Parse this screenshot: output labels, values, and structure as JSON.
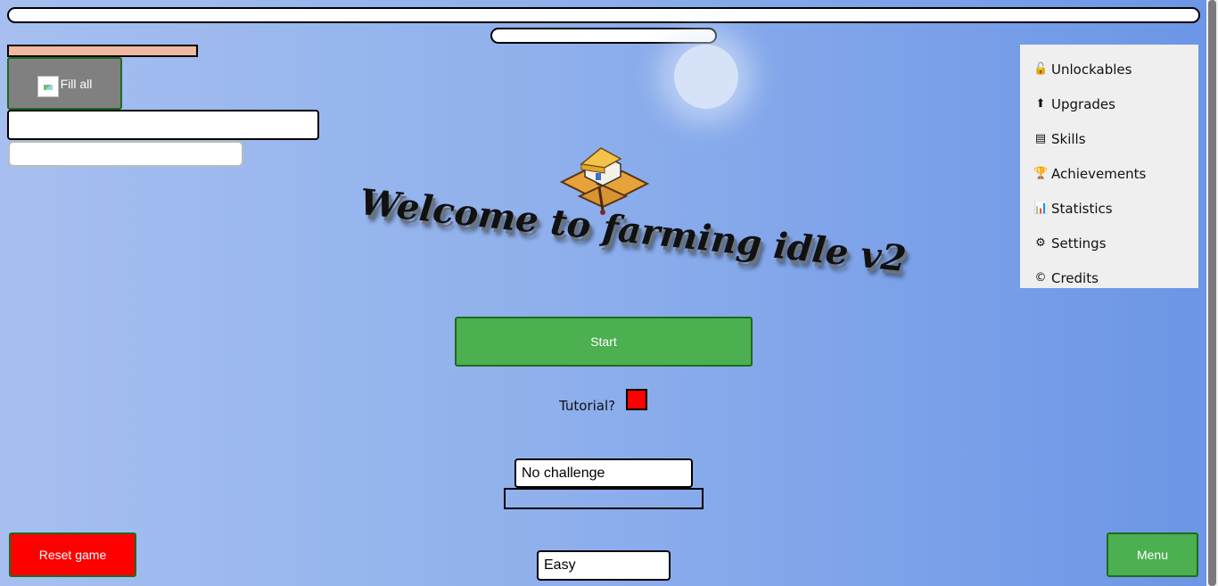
{
  "top_bars": {},
  "fill_all_button": {
    "label": "Fill all",
    "icon": "broken-image-icon"
  },
  "side_menu": {
    "items": [
      {
        "icon": "unlock-icon",
        "glyph": "🔓",
        "label": "Unlockables"
      },
      {
        "icon": "upgrade-arrow-icon",
        "glyph": "⬆",
        "label": "Upgrades"
      },
      {
        "icon": "skills-icon",
        "glyph": "▤",
        "label": "Skills"
      },
      {
        "icon": "trophy-icon",
        "glyph": "🏆",
        "label": "Achievements"
      },
      {
        "icon": "chart-icon",
        "glyph": "📊",
        "label": "Statistics"
      },
      {
        "icon": "gear-icon",
        "glyph": "⚙",
        "label": "Settings"
      },
      {
        "icon": "copyright-icon",
        "glyph": "©",
        "label": "Credits"
      }
    ]
  },
  "main": {
    "title": "Welcome to farming idle v2",
    "start_label": "Start",
    "tutorial_label": "Tutorial?",
    "tutorial_checked": false,
    "challenge_select": "No challenge",
    "difficulty_select": "Easy"
  },
  "footer": {
    "reset_label": "Reset game",
    "menu_label": "Menu"
  },
  "colors": {
    "start_green": "#4caf50",
    "reset_red": "#ff0000",
    "tutorial_box": "#ff0000",
    "progress_fill": "#f0b8a0",
    "menu_panel": "#efefef"
  }
}
